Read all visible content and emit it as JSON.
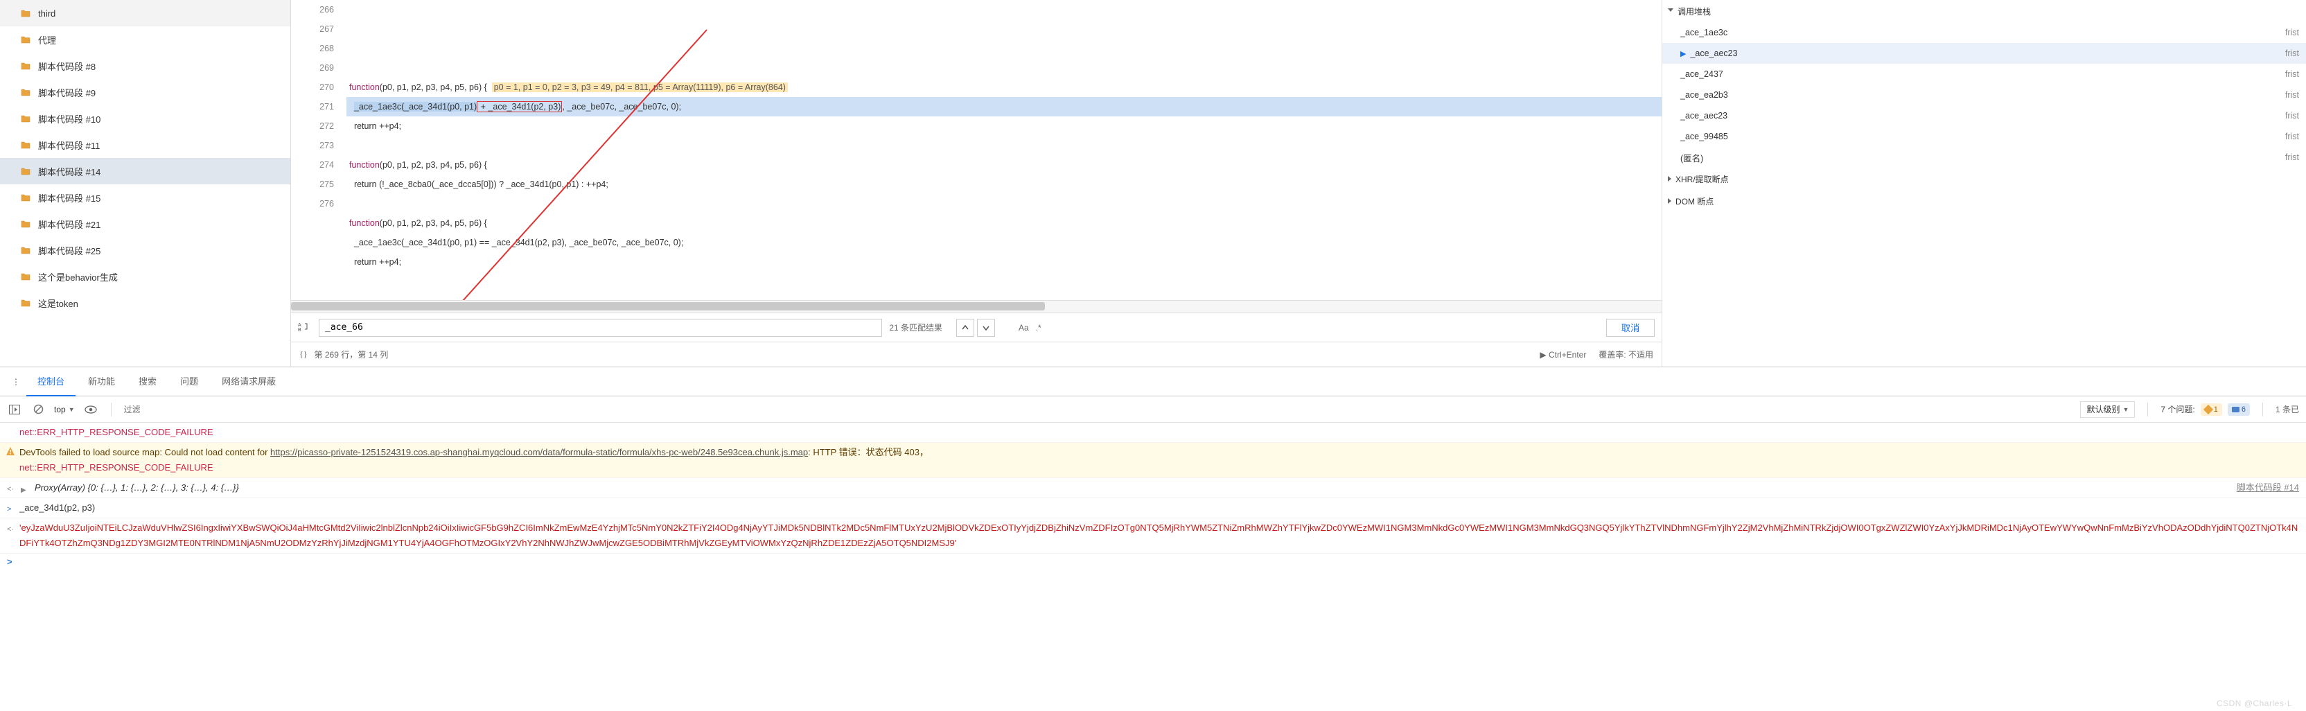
{
  "sidebar": {
    "items": [
      {
        "label": "third",
        "selected": false
      },
      {
        "label": "代理",
        "selected": false
      },
      {
        "label": "脚本代码段 #8",
        "selected": false
      },
      {
        "label": "脚本代码段 #9",
        "selected": false
      },
      {
        "label": "脚本代码段 #10",
        "selected": false
      },
      {
        "label": "脚本代码段 #11",
        "selected": false
      },
      {
        "label": "脚本代码段 #14",
        "selected": true
      },
      {
        "label": "脚本代码段 #15",
        "selected": false
      },
      {
        "label": "脚本代码段 #21",
        "selected": false
      },
      {
        "label": "脚本代码段 #25",
        "selected": false
      },
      {
        "label": "这个是behavior生成",
        "selected": false
      },
      {
        "label": "这是token",
        "selected": false
      }
    ]
  },
  "editor": {
    "first_line_no": 266,
    "lines": [
      {
        "n": 266,
        "kind": "fn",
        "hint": "p0 = 1, p1 = 0, p2 = 3, p3 = 49, p4 = 811, p5 = Array(11119), p6 = Array(864)"
      },
      {
        "n": 267,
        "kind": "exec",
        "pre": "_ace_1ae3c(",
        "sel": "_ace_34d1(p0, p1)",
        "box": " + _ace_34d1(p2, p3)",
        "post": ", _ace_be07c, _ace_be07c, 0);"
      },
      {
        "n": 268,
        "kind": "plain",
        "text": "  return ++p4;"
      },
      {
        "n": 269,
        "kind": "plain",
        "text": ""
      },
      {
        "n": 270,
        "kind": "fn2",
        "text": "function(p0, p1, p2, p3, p4, p5, p6) {"
      },
      {
        "n": 271,
        "kind": "plain",
        "text": "  return (!_ace_8cba0(_ace_dcca5[0])) ? _ace_34d1(p0, p1) : ++p4;"
      },
      {
        "n": 272,
        "kind": "plain",
        "text": ""
      },
      {
        "n": 273,
        "kind": "fn2",
        "text": "function(p0, p1, p2, p3, p4, p5, p6) {"
      },
      {
        "n": 274,
        "kind": "plain",
        "text": "  _ace_1ae3c(_ace_34d1(p0, p1) == _ace_34d1(p2, p3), _ace_be07c, _ace_be07c, 0);"
      },
      {
        "n": 275,
        "kind": "plain",
        "text": "  return ++p4;"
      },
      {
        "n": 276,
        "kind": "plain",
        "text": ""
      }
    ],
    "find": {
      "value": "_ace_66",
      "results": "21 条匹配结果",
      "aa": "Aa",
      "regex": ".*",
      "cancel": "取消"
    },
    "status": {
      "brackets": "{}",
      "pos": "第 269 行，第 14 列",
      "run_hint": "▶ Ctrl+Enter",
      "coverage": "覆盖率: 不适用"
    }
  },
  "right": {
    "callstack_label": "调用堆栈",
    "stack": [
      {
        "fn": "_ace_1ae3c",
        "src": "frist",
        "current": false
      },
      {
        "fn": "_ace_aec23",
        "src": "frist",
        "current": true
      },
      {
        "fn": "_ace_2437",
        "src": "frist",
        "current": false
      },
      {
        "fn": "_ace_ea2b3",
        "src": "frist",
        "current": false
      },
      {
        "fn": "_ace_aec23",
        "src": "frist",
        "current": false
      },
      {
        "fn": "_ace_99485",
        "src": "frist",
        "current": false
      },
      {
        "fn": "(匿名)",
        "src": "frist",
        "current": false
      }
    ],
    "xhr_label": "XHR/提取断点",
    "dom_label": "DOM 断点"
  },
  "tabs": {
    "console": "控制台",
    "whatsnew": "新功能",
    "search": "搜索",
    "issues": "问题",
    "netblock": "网络请求屏蔽"
  },
  "console": {
    "context": "top",
    "filter_placeholder": "过滤",
    "level": "默认级别",
    "issues_prefix": "7 个问题:",
    "warn_count": "1",
    "info_count": "6",
    "settings_tail": "1 条已",
    "rows": {
      "err1": "net::ERR_HTTP_RESPONSE_CODE_FAILURE",
      "warn_prefix": "DevTools failed to load source map: Could not load content for ",
      "warn_url": "https://picasso-private-1251524319.cos.ap-shanghai.myqcloud.com/data/formula-static/formula/xhs-pc-web/248.5e93cea.chunk.js.map",
      "warn_suffix": ": HTTP 错误：状态代码 403，",
      "err2": "net::ERR_HTTP_RESPONSE_CODE_FAILURE",
      "proxy": "Proxy(Array) {0: {…}, 1: {…}, 2: {…}, 3: {…}, 4: {…}}",
      "proxy_src": "脚本代码段 #14",
      "cmd": "_ace_34d1(p2, p3)",
      "result": "'eyJzaWduU3ZuIjoiNTEiLCJzaWduVHlwZSI6IngxIiwiYXBwSWQiOiJ4aHMtcGMtd2ViIiwic2lnblZlcnNpb24iOiIxIiwicGF5bG9hZCI6ImNkZmEwMzE4YzhjMTc5NmY0N2kZTFiY2I4ODg4NjAyYTJiMDk5NDBlNTk2MDc5NmFlMTUxYzU2MjBlODVkZDExOTIyYjdjZDBjZhiNzVmZDFIzOTg0NTQ5MjRhYWM5ZTNiZmRhMWZhYTFlYjkwZDc0YWEzMWI1NGM3MmNkdGc0YWEzMWI1NGM3MmNkdGQ3NGQ5YjlkYThZTVlNDhmNGFmYjlhY2ZjM2VhMjZhMiNTRkZjdjOWI0OTgxZWZlZWI0YzAxYjJkMDRiMDc1NjAyOTEwYWYwQwNnFmMzBiYzVhODAzODdhYjdiNTQ0ZTNjOTk4NDFiYTk4OTZhZmQ3NDg1ZDY3MGI2MTE0NTRlNDM1NjA5NmU2ODMzYzRhYjJiMzdjNGM1YTU4YjA4OGFhOTMzOGIxY2VhY2NhNWJhZWJwMjcwZGE5ODBiMTRhMjVkZGEyMTViOWMxYzQzNjRhZDE1ZDEzZjA5OTQ5NDI2MSJ9'"
    }
  },
  "watermark": "CSDN @Charles·L"
}
